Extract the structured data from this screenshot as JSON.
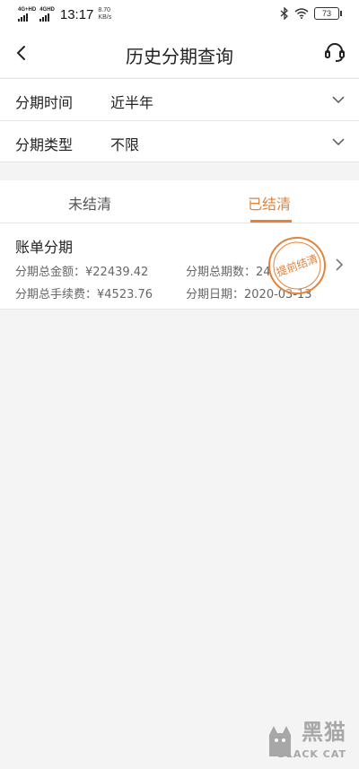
{
  "status_bar": {
    "network1": "4G+HD",
    "network2": "4GHD",
    "time": "13:17",
    "speed_value": "8.70",
    "speed_unit": "KB/s",
    "battery": "73"
  },
  "header": {
    "title": "历史分期查询",
    "back_icon": "chevron-left-icon",
    "service_icon": "headset-icon"
  },
  "filters": [
    {
      "label": "分期时间",
      "value": "近半年"
    },
    {
      "label": "分期类型",
      "value": "不限"
    }
  ],
  "tabs": {
    "unpaid": "未结清",
    "paid": "已结清",
    "active": "paid"
  },
  "record": {
    "title": "账单分期",
    "total_amount_label": "分期总金额：",
    "total_amount": "¥22439.42",
    "installments_label": "分期总期数：",
    "installments": "24",
    "total_fee_label": "分期总手续费：",
    "total_fee": "¥4523.76",
    "date_label": "分期日期：",
    "date": "2020-03-13",
    "stamp": "提前结清"
  },
  "watermark": {
    "brand": "黑猫",
    "sub": "BLACK CAT"
  },
  "colors": {
    "accent": "#e2823b",
    "background": "#f4f4f4"
  }
}
